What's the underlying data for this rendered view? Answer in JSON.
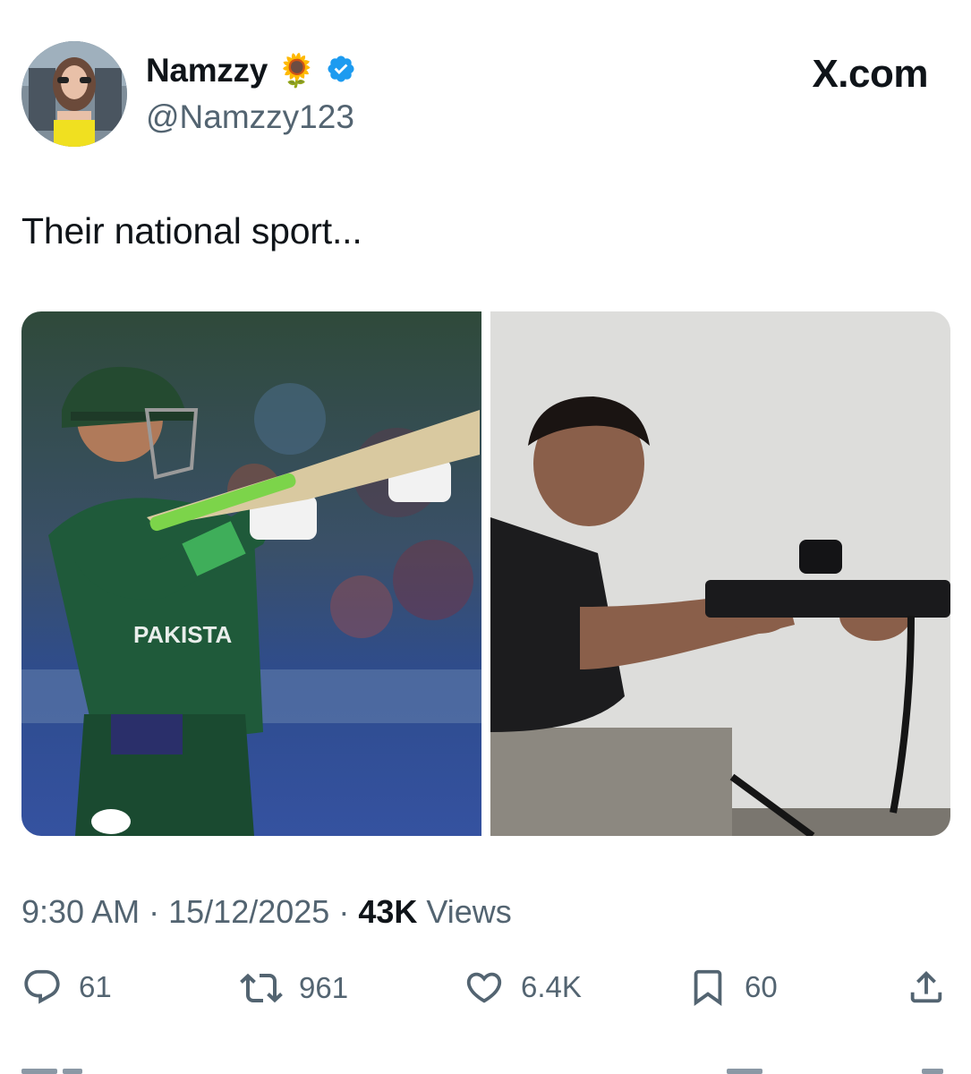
{
  "author": {
    "display_name": "Namzzy",
    "emoji": "🌻",
    "handle": "@Namzzy123",
    "verified": true
  },
  "brand": "X.com",
  "tweet": {
    "text": "Their national sport..."
  },
  "meta": {
    "time": "9:30 AM",
    "separator": "·",
    "date": "15/12/2025",
    "views_count": "43K",
    "views_label": "Views"
  },
  "actions": {
    "replies": "61",
    "reposts": "961",
    "likes": "6.4K",
    "bookmarks": "60"
  },
  "colors": {
    "text": "#0f1419",
    "secondary": "#536471",
    "verified": "#1d9bf0"
  },
  "icons": [
    "reply-icon",
    "repost-icon",
    "like-icon",
    "bookmark-icon",
    "share-icon",
    "verified-badge-icon"
  ]
}
